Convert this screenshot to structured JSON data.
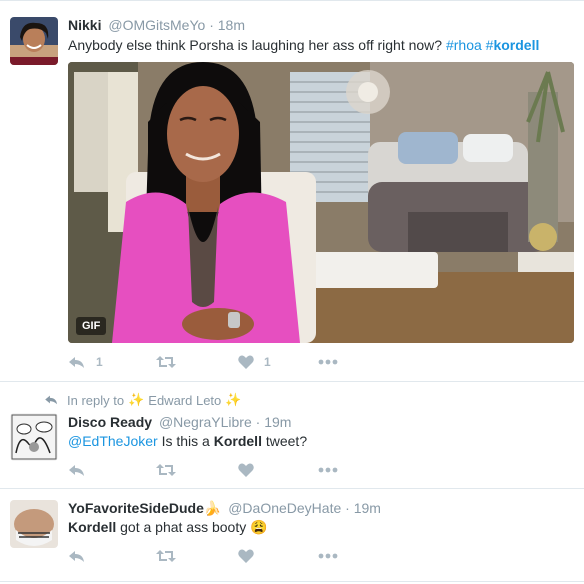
{
  "tweets": [
    {
      "name": "Nikki",
      "handle": "@OMGitsMeYo",
      "dot": "·",
      "time": "18m",
      "text_main": "Anybody else think Porsha is laughing her ass off right now?",
      "hashtag1": "#rhoa",
      "hashtag2_hash": "#",
      "hashtag2_word": "kordell",
      "media_badge": "GIF",
      "reply_count": "1",
      "like_count": "1"
    },
    {
      "reply_prefix": "In reply to",
      "reply_user": "Edward Leto",
      "name": "Disco Ready",
      "handle": "@NegraYLibre",
      "dot": "·",
      "time": "19m",
      "mention": "@EdTheJoker",
      "text_pre": " Is this a ",
      "text_bold": "Kordell",
      "text_post": " tweet?"
    },
    {
      "name": "YoFavoriteSideDude",
      "name_emoji": "🍌",
      "handle": "@DaOneDeyHate",
      "dot": "·",
      "time": "19m",
      "text_bold": "Kordell",
      "text_post": " got a phat ass booty",
      "text_emoji": "😩"
    }
  ],
  "icons": {
    "reply": "reply-icon",
    "retweet": "retweet-icon",
    "like": "heart-icon",
    "more": "more-icon",
    "sparkle": "sparkle-icon",
    "reply_arrow": "reply-arrow-icon"
  },
  "colors": {
    "link": "#1b95e0",
    "muted": "#8899a6",
    "icon": "#aab8c2",
    "name": "#292f33",
    "divider": "#e1e8ed",
    "emoji_sparkle": "#b48cf0"
  }
}
